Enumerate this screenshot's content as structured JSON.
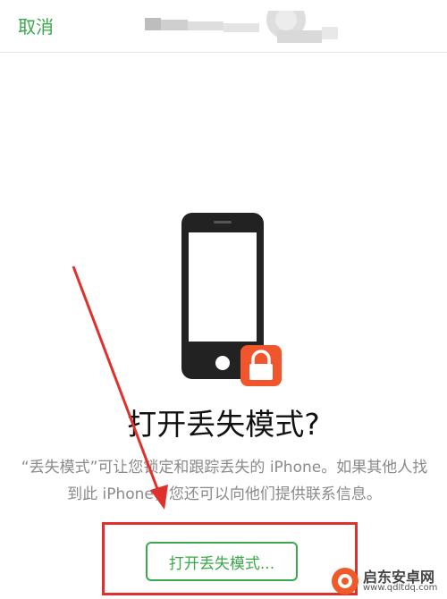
{
  "nav": {
    "cancel_label": "取消"
  },
  "main": {
    "title": "打开丢失模式?",
    "description": "“丢失模式”可让您锁定和跟踪丢失的 iPhone。如果其他人找到此 iPhone，您还可以向他们提供联系信息。",
    "button_label": "打开丢失模式..."
  },
  "watermark": {
    "name": "启东安卓网",
    "url": "www.qdltdq.com"
  },
  "colors": {
    "accent_green": "#3aa94a",
    "annotation_red": "#e0302c",
    "lock_orange": "#f0552b",
    "phone_dark": "#222222"
  },
  "icons": {
    "phone": "phone-icon",
    "lock": "lock-icon"
  }
}
